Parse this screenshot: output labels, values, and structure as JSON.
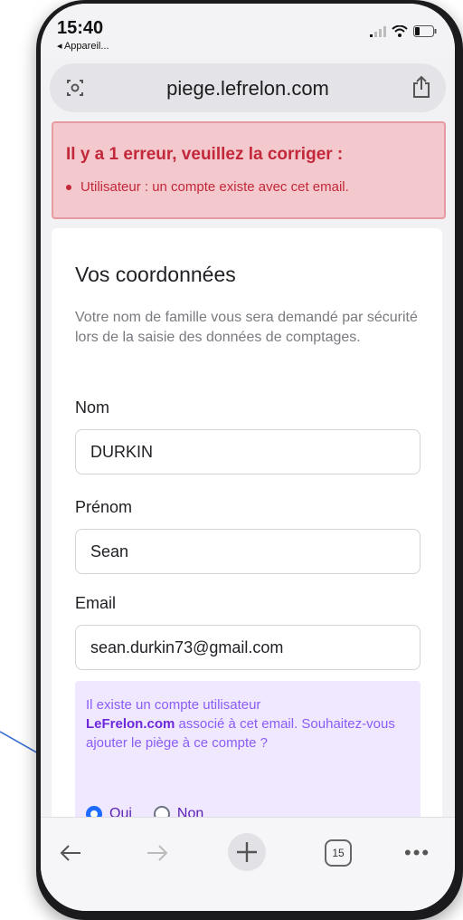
{
  "status_bar": {
    "time": "15:40",
    "back_app": "◂ Appareil..."
  },
  "browser": {
    "url": "piege.lefrelon.com",
    "tabs_count": "15"
  },
  "error": {
    "title": "Il y a 1 erreur, veuillez la corriger :",
    "items": [
      "Utilisateur : un compte existe avec cet email."
    ],
    "color": "#c2283a"
  },
  "form": {
    "section_title": "Vos coordonnées",
    "intro": "Votre nom de famille vous sera demandé par sécurité lors de la saisie des données de comptages.",
    "fields": [
      {
        "label": "Nom",
        "value": "DURKIN"
      },
      {
        "label": "Prénom",
        "value": "Sean"
      },
      {
        "label": "Email",
        "value": "sean.durkin73@gmail.com"
      }
    ],
    "notice": {
      "text_before": "Il existe un compte utilisateur",
      "brand": "LeFrelon.com",
      "text_after": " associé à cet email. Souhaitez-vous ajouter le piège à ce compte ?",
      "options": [
        {
          "label": "Oui",
          "selected": true
        },
        {
          "label": "Non",
          "selected": false
        }
      ]
    }
  },
  "toolbar": {
    "icons": [
      "back-arrow-icon",
      "forward-arrow-icon",
      "new-tab-plus-icon",
      "tabs-icon",
      "more-icon"
    ]
  },
  "colors": {
    "accent": "#1e6bff",
    "notice_bg": "#efe8ff",
    "notice_text": "#8b5cf6",
    "arrow": "#3b6fd0"
  }
}
